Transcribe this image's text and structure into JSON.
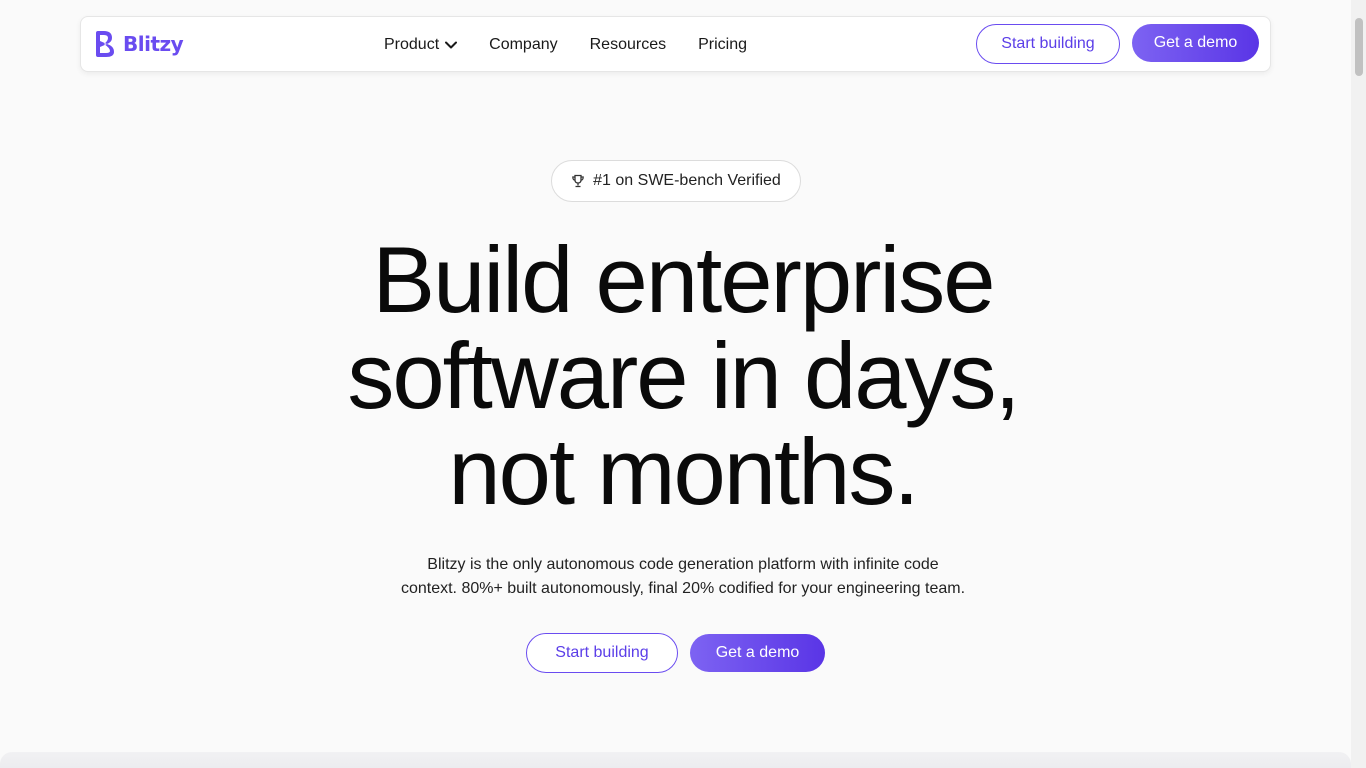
{
  "brand": {
    "name": "Blitzy",
    "color": "#6a4cf0"
  },
  "nav": {
    "links": [
      {
        "label": "Product",
        "has_dropdown": true
      },
      {
        "label": "Company"
      },
      {
        "label": "Resources"
      },
      {
        "label": "Pricing"
      }
    ],
    "start_building_label": "Start building",
    "get_demo_label": "Get a demo"
  },
  "badge": {
    "icon": "trophy-icon",
    "text": "#1 on SWE-bench Verified"
  },
  "hero": {
    "title_line1": "Build enterprise",
    "title_line2": "software in days,",
    "title_line3": "not months.",
    "subtitle_line1": "Blitzy is the only autonomous code generation platform with infinite code",
    "subtitle_line2": "context. 80%+ built autonomously, final 20% codified for your engineering team.",
    "start_building_label": "Start building",
    "get_demo_label": "Get a demo"
  },
  "colors": {
    "accent": "#5b3ee8",
    "accent_light": "#7d63f2"
  }
}
